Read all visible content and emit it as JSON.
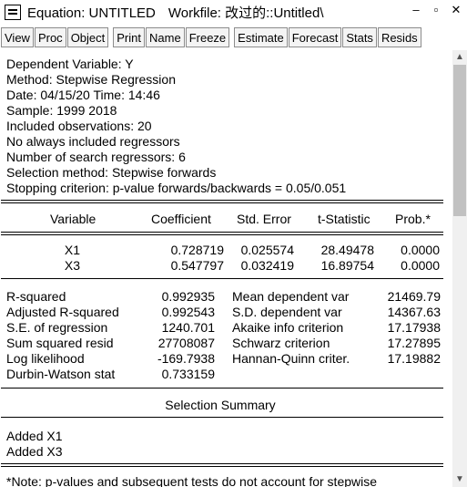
{
  "window": {
    "title": "Equation: UNTITLED",
    "workfile": "Workfile: 改过的::Untitled\\"
  },
  "toolbar": {
    "buttons": [
      "View",
      "Proc",
      "Object",
      "Print",
      "Name",
      "Freeze",
      "Estimate",
      "Forecast",
      "Stats",
      "Resids"
    ]
  },
  "header": {
    "lines": [
      "Dependent Variable: Y",
      "Method: Stepwise Regression",
      "Date: 04/15/20   Time: 14:46",
      "Sample: 1999 2018",
      "Included observations: 20",
      "No always included regressors",
      "Number of search regressors: 6",
      "Selection method: Stepwise forwards",
      "Stopping criterion: p-value forwards/backwards = 0.05/0.051"
    ]
  },
  "coef_table": {
    "columns": [
      "Variable",
      "Coefficient",
      "Std. Error",
      "t-Statistic",
      "Prob.*"
    ],
    "rows": [
      [
        "X1",
        "0.728719",
        "0.025574",
        "28.49478",
        "0.0000"
      ],
      [
        "X3",
        "0.547797",
        "0.032419",
        "16.89754",
        "0.0000"
      ]
    ]
  },
  "stats": {
    "left": [
      [
        "R-squared",
        "0.992935"
      ],
      [
        "Adjusted R-squared",
        "0.992543"
      ],
      [
        "S.E. of regression",
        "1240.701"
      ],
      [
        "Sum squared resid",
        "27708087"
      ],
      [
        "Log likelihood",
        "-169.7938"
      ],
      [
        "Durbin-Watson stat",
        "0.733159"
      ]
    ],
    "right": [
      [
        "Mean dependent var",
        "21469.79"
      ],
      [
        "S.D. dependent var",
        "14367.63"
      ],
      [
        "Akaike info criterion",
        "17.17938"
      ],
      [
        "Schwarz criterion",
        "17.27895"
      ],
      [
        "Hannan-Quinn criter.",
        "17.19882"
      ]
    ]
  },
  "selection": {
    "title": "Selection Summary",
    "items": [
      "Added X1",
      "Added X3"
    ]
  },
  "note": "*Note: p-values and subsequent tests do not account for stepwise"
}
